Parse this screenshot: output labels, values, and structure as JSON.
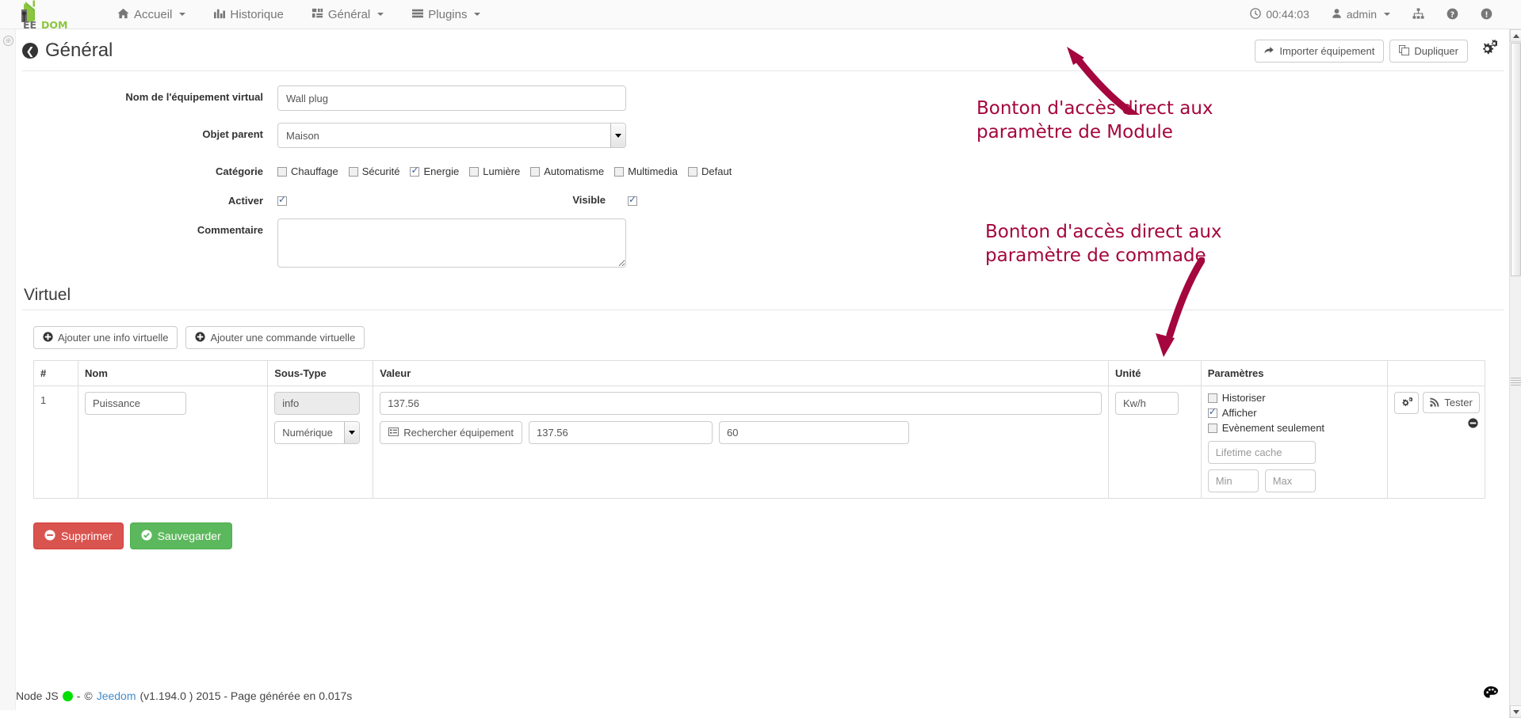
{
  "navbar": {
    "brand": "JEEDOM",
    "items": [
      {
        "label": "Accueil",
        "icon": "home-icon",
        "caret": true
      },
      {
        "label": "Historique",
        "icon": "chart-bar-icon",
        "caret": false
      },
      {
        "label": "Général",
        "icon": "grid-icon",
        "caret": true
      },
      {
        "label": "Plugins",
        "icon": "list-icon",
        "caret": true
      }
    ],
    "right": {
      "clock_icon": "clock-icon",
      "time": "00:44:03",
      "user_icon": "user-icon",
      "user": "admin",
      "network_icon": "sitemap-icon",
      "help_icon": "question-circle-icon",
      "info_icon": "exclamation-circle-icon"
    }
  },
  "header": {
    "title": "Général",
    "back_icon": "arrow-circle-left-icon",
    "import_label": "Importer équipement",
    "import_icon": "share-icon",
    "duplicate_label": "Dupliquer",
    "duplicate_icon": "copy-icon",
    "gear_icon": "gears-icon"
  },
  "form": {
    "name_label": "Nom de l'équipement virtual",
    "name_value": "Wall plug",
    "parent_label": "Objet parent",
    "parent_value": "Maison",
    "parent_options": [
      "Maison"
    ],
    "category_label": "Catégorie",
    "categories": [
      {
        "label": "Chauffage",
        "checked": false
      },
      {
        "label": "Sécurité",
        "checked": false
      },
      {
        "label": "Energie",
        "checked": true
      },
      {
        "label": "Lumière",
        "checked": false
      },
      {
        "label": "Automatisme",
        "checked": false
      },
      {
        "label": "Multimedia",
        "checked": false
      },
      {
        "label": "Defaut",
        "checked": false
      }
    ],
    "activate_label": "Activer",
    "activate_checked": true,
    "visible_label": "Visible",
    "visible_checked": true,
    "comment_label": "Commentaire",
    "comment_value": ""
  },
  "section": {
    "title": "Virtuel",
    "add_info_label": "Ajouter une info virtuelle",
    "add_cmd_label": "Ajouter une commande virtuelle",
    "plus_icon": "plus-circle-icon"
  },
  "table": {
    "headers": [
      "#",
      "Nom",
      "Sous-Type",
      "Valeur",
      "Unité",
      "Paramètres",
      ""
    ],
    "rows": [
      {
        "index": "1",
        "name": "Puissance",
        "type": "info",
        "subtype": "Numérique",
        "subtype_options": [
          "Numérique"
        ],
        "value": "137.56",
        "search_btn_label": "Rechercher équipement",
        "search_btn_icon": "list-alt-icon",
        "value2": "137.56",
        "value3": "60",
        "unit": "Kw/h",
        "params": [
          {
            "label": "Historiser",
            "checked": false
          },
          {
            "label": "Afficher",
            "checked": true
          },
          {
            "label": "Evènement seulement",
            "checked": false
          }
        ],
        "lifetime_placeholder": "Lifetime cache",
        "lifetime_value": "",
        "min_placeholder": "Min",
        "min_value": "",
        "max_placeholder": "Max",
        "max_value": "",
        "config_icon": "gears-icon",
        "test_label": "Tester",
        "test_icon": "rss-icon",
        "remove_icon": "minus-circle-icon"
      }
    ]
  },
  "actions": {
    "delete_label": "Supprimer",
    "delete_icon": "minus-circle-icon",
    "save_label": "Sauvegarder",
    "save_icon": "check-circle-icon"
  },
  "footer": {
    "nodejs_label": "Node JS",
    "status_color": "#00e000",
    "separator": "-",
    "copyright": "©",
    "brand_link": "Jeedom",
    "version_text": "(v1.194.0 ) 2015 - Page générée en 0.017s",
    "palette_icon": "palette-icon"
  },
  "annotations": [
    {
      "id": "anno1",
      "text": "Bonton d'accès direct aux paramètre de Module",
      "color": "#a4063d"
    },
    {
      "id": "anno2",
      "text": "Bonton d'accès direct aux paramètre de commade",
      "color": "#a4063d"
    }
  ]
}
